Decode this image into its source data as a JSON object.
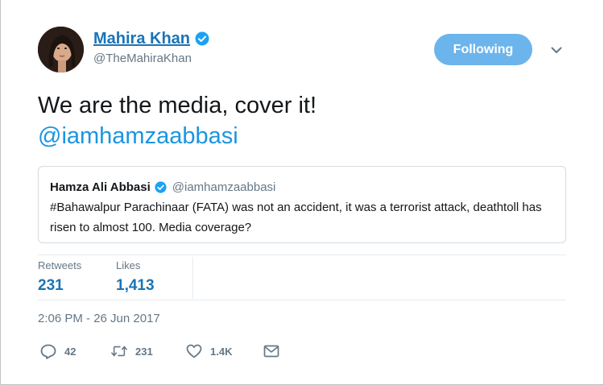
{
  "author": {
    "name": "Mahira Khan",
    "handle": "@TheMahiraKhan",
    "verified": true
  },
  "follow_button": {
    "label": "Following",
    "color": "#6cb4ec"
  },
  "tweet": {
    "text": "We are the media, cover it!",
    "mention": "@iamhamzaabbasi"
  },
  "quoted_tweet": {
    "name": "Hamza Ali Abbasi",
    "handle": "@iamhamzaabbasi",
    "verified": true,
    "text": "#Bahawalpur Parachinaar (FATA) was not an accident, it was a terrorist attack, deathtoll has risen to almost 100. Media coverage?"
  },
  "stats": {
    "retweets_label": "Retweets",
    "retweets_value": "231",
    "likes_label": "Likes",
    "likes_value": "1,413"
  },
  "timestamp": "2:06 PM - 26 Jun 2017",
  "actions": {
    "reply": {
      "icon": "reply-icon",
      "count": "42"
    },
    "retweet": {
      "icon": "retweet-icon",
      "count": "231"
    },
    "like": {
      "icon": "heart-icon",
      "count": "1.4K"
    },
    "message": {
      "icon": "envelope-icon"
    }
  },
  "colors": {
    "link": "#1b95e0",
    "name": "#1b74b6",
    "secondary_text": "#657786"
  }
}
